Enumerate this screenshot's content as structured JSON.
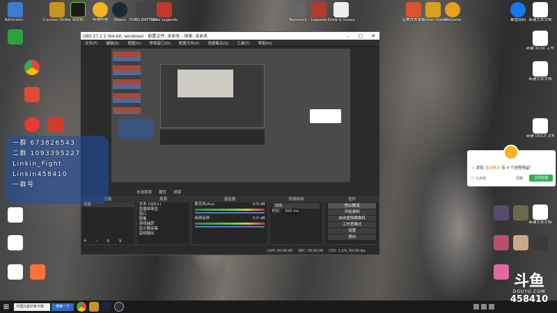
{
  "desktop": {
    "icons_left": [
      {
        "label": "Administr...",
        "color": "#3b7bd4"
      },
      {
        "label": "",
        "color": "#ffffff"
      },
      {
        "label": "",
        "color": "#e04b2f"
      },
      {
        "label": "",
        "color": "#2f9e41"
      },
      {
        "label": "",
        "color": "#4285f4"
      },
      {
        "label": "",
        "color": "#1ea9e0"
      },
      {
        "label": "",
        "color": "#e53935"
      },
      {
        "label": "",
        "color": "#555555"
      }
    ],
    "icons_top": [
      {
        "label": "Counter-Strike Global Of...",
        "color": "#c79320"
      },
      {
        "label": "KOOK",
        "color": "#1a1a1a"
      },
      {
        "label": "哔哩哔哩",
        "color": "#2f8fe0"
      },
      {
        "label": "Steam",
        "color": "#1b2838"
      },
      {
        "label": "PUBG BATTLEGR...",
        "color": "#dfa534"
      },
      {
        "label": "Apex Legends",
        "color": "#c0392b"
      }
    ],
    "icons_top_mid": [
      {
        "label": "Recovery",
        "color": "#666666"
      },
      {
        "label": "Legends",
        "color": "#b23a2c"
      },
      {
        "label": "Draw & Guess",
        "color": "#eeeeee"
      }
    ],
    "icons_top_right": [
      {
        "label": "完美世界竞技",
        "color": "#d9542f"
      },
      {
        "label": "Counter-Global Of...",
        "color": "#d9a020"
      },
      {
        "label": "WeGame",
        "color": "#e8a020"
      },
      {
        "label": "暴雪战网",
        "color": "#1478f0"
      },
      {
        "label": "新建文本文档",
        "color": "#ffffff"
      }
    ],
    "icons_right_col": [
      {
        "label": "新建 XLSX 工作表",
        "color": "#ffffff"
      },
      {
        "label": "新建文本文档",
        "color": "#ffffff"
      },
      {
        "label": "新建 DOCX 文档",
        "color": "#ffffff"
      },
      {
        "label": "新建文本文档",
        "color": "#ffffff"
      }
    ]
  },
  "obs": {
    "title": "OBS 27.2.2 (64-bit, windows) - 配置文件: 未命名 - 场景: 未命名",
    "menu": [
      "文件(F)",
      "编辑(E)",
      "视图(V)",
      "停靠窗口(D)",
      "配置文件(P)",
      "场景集合(S)",
      "工具(T)",
      "帮助(H)"
    ],
    "preview_bar": [
      "未选择源",
      "属性",
      "滤镜"
    ],
    "docks": {
      "scenes": {
        "header": "场景",
        "items": [
          "场景"
        ]
      },
      "sources": {
        "header": "来源",
        "items": [
          "文本 (GDI+)",
          "直播姬客显",
          "窗口",
          "图像",
          "游戏捕获",
          "显示器采集",
          "音频输出"
        ]
      },
      "mixer": {
        "header": "混音器",
        "items": [
          {
            "name": "麦克风/Aux",
            "db": "0.0 dB"
          },
          {
            "name": "桌面音频",
            "db": "0.0 dB"
          }
        ]
      },
      "transitions": {
        "header": "转场特效",
        "mode": "淡出",
        "duration_label": "时长",
        "duration": "300 ms"
      },
      "controls": {
        "header": "控件",
        "buttons": [
          "停止推流",
          "开始录制",
          "启动虚拟摄像机",
          "工作室模式",
          "设置",
          "退出"
        ]
      }
    },
    "status": {
      "live": "LIVE: 00:00:00",
      "rec": "REC: 00:00:00",
      "cpu": "CPU: 1.2%, 60.00 fps"
    }
  },
  "overlay": {
    "lines": [
      "一群 673826543",
      "二群 1093395227",
      "Linkin_Fight",
      "Linkin458410",
      "一群号"
    ]
  },
  "popup": {
    "message_prefix": "发现",
    "message_highlight": "驱动精灵",
    "message_suffix": "有 4 个进程残留！",
    "checkbox": "已启用",
    "dismiss": "忽略",
    "action": "立即处理"
  },
  "taskbar": {
    "search_text": "中国元素印象卡牌",
    "button_text": "搜索一下"
  },
  "watermark": {
    "logo": "斗鱼",
    "site": "DOUYU.COM",
    "room_id": "458410"
  }
}
